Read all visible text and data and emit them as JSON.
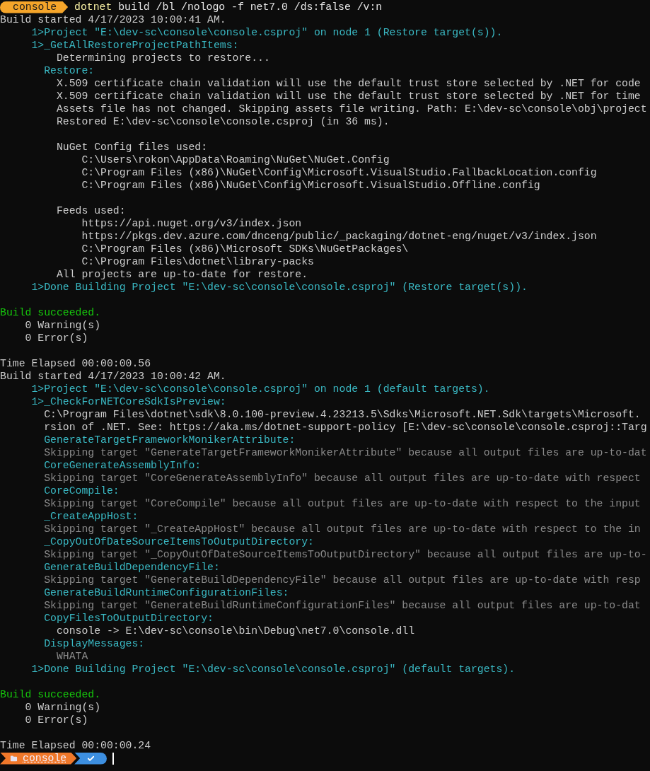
{
  "prompt": {
    "segment": "console",
    "command": "dotnet",
    "args": "build /bl /nologo -f net7.0 /ds:false /v:n"
  },
  "lines": [
    {
      "kind": "info",
      "text": "Build started 4/17/2023 10:00:41 AM."
    },
    {
      "kind": "target",
      "text": "     1>Project \"E:\\dev-sc\\console\\console.csproj\" on node 1 (Restore target(s))."
    },
    {
      "kind": "target",
      "text": "     1>_GetAllRestoreProjectPathItems:"
    },
    {
      "kind": "info",
      "text": "         Determining projects to restore..."
    },
    {
      "kind": "target",
      "text": "       Restore:"
    },
    {
      "kind": "info",
      "text": "         X.509 certificate chain validation will use the default trust store selected by .NET for code"
    },
    {
      "kind": "info",
      "text": "         X.509 certificate chain validation will use the default trust store selected by .NET for time"
    },
    {
      "kind": "info",
      "text": "         Assets file has not changed. Skipping assets file writing. Path: E:\\dev-sc\\console\\obj\\project"
    },
    {
      "kind": "info",
      "text": "         Restored E:\\dev-sc\\console\\console.csproj (in 36 ms)."
    },
    {
      "kind": "blank"
    },
    {
      "kind": "info",
      "text": "         NuGet Config files used:"
    },
    {
      "kind": "info",
      "text": "             C:\\Users\\rokon\\AppData\\Roaming\\NuGet\\NuGet.Config"
    },
    {
      "kind": "info",
      "text": "             C:\\Program Files (x86)\\NuGet\\Config\\Microsoft.VisualStudio.FallbackLocation.config"
    },
    {
      "kind": "info",
      "text": "             C:\\Program Files (x86)\\NuGet\\Config\\Microsoft.VisualStudio.Offline.config"
    },
    {
      "kind": "blank"
    },
    {
      "kind": "info",
      "text": "         Feeds used:"
    },
    {
      "kind": "info",
      "text": "             https://api.nuget.org/v3/index.json"
    },
    {
      "kind": "info",
      "text": "             https://pkgs.dev.azure.com/dnceng/public/_packaging/dotnet-eng/nuget/v3/index.json"
    },
    {
      "kind": "info",
      "text": "             C:\\Program Files (x86)\\Microsoft SDKs\\NuGetPackages\\"
    },
    {
      "kind": "info",
      "text": "             C:\\Program Files\\dotnet\\library-packs"
    },
    {
      "kind": "info",
      "text": "         All projects are up-to-date for restore."
    },
    {
      "kind": "target",
      "text": "     1>Done Building Project \"E:\\dev-sc\\console\\console.csproj\" (Restore target(s))."
    },
    {
      "kind": "blank"
    },
    {
      "kind": "success",
      "text": "Build succeeded."
    },
    {
      "kind": "info",
      "text": "    0 Warning(s)"
    },
    {
      "kind": "info",
      "text": "    0 Error(s)"
    },
    {
      "kind": "blank"
    },
    {
      "kind": "info",
      "text": "Time Elapsed 00:00:00.56"
    },
    {
      "kind": "info",
      "text": "Build started 4/17/2023 10:00:42 AM."
    },
    {
      "kind": "target",
      "text": "     1>Project \"E:\\dev-sc\\console\\console.csproj\" on node 1 (default targets)."
    },
    {
      "kind": "target",
      "text": "     1>_CheckForNETCoreSdkIsPreview:"
    },
    {
      "kind": "info",
      "text": "       C:\\Program Files\\dotnet\\sdk\\8.0.100-preview.4.23213.5\\Sdks\\Microsoft.NET.Sdk\\targets\\Microsoft."
    },
    {
      "kind": "info",
      "text": "       rsion of .NET. See: https://aka.ms/dotnet-support-policy [E:\\dev-sc\\console\\console.csproj::Targ"
    },
    {
      "kind": "target",
      "text": "       GenerateTargetFrameworkMonikerAttribute:"
    },
    {
      "kind": "dim",
      "text": "       Skipping target \"GenerateTargetFrameworkMonikerAttribute\" because all output files are up-to-dat"
    },
    {
      "kind": "target",
      "text": "       CoreGenerateAssemblyInfo:"
    },
    {
      "kind": "dim",
      "text": "       Skipping target \"CoreGenerateAssemblyInfo\" because all output files are up-to-date with respect"
    },
    {
      "kind": "target",
      "text": "       CoreCompile:"
    },
    {
      "kind": "dim",
      "text": "       Skipping target \"CoreCompile\" because all output files are up-to-date with respect to the input"
    },
    {
      "kind": "target",
      "text": "       _CreateAppHost:"
    },
    {
      "kind": "dim",
      "text": "       Skipping target \"_CreateAppHost\" because all output files are up-to-date with respect to the in"
    },
    {
      "kind": "target",
      "text": "       _CopyOutOfDateSourceItemsToOutputDirectory:"
    },
    {
      "kind": "dim",
      "text": "       Skipping target \"_CopyOutOfDateSourceItemsToOutputDirectory\" because all output files are up-to-"
    },
    {
      "kind": "target",
      "text": "       GenerateBuildDependencyFile:"
    },
    {
      "kind": "dim",
      "text": "       Skipping target \"GenerateBuildDependencyFile\" because all output files are up-to-date with resp"
    },
    {
      "kind": "target",
      "text": "       GenerateBuildRuntimeConfigurationFiles:"
    },
    {
      "kind": "dim",
      "text": "       Skipping target \"GenerateBuildRuntimeConfigurationFiles\" because all output files are up-to-dat"
    },
    {
      "kind": "target",
      "text": "       CopyFilesToOutputDirectory:"
    },
    {
      "kind": "info",
      "text": "         console -> E:\\dev-sc\\console\\bin\\Debug\\net7.0\\console.dll"
    },
    {
      "kind": "target",
      "text": "       DisplayMessages:"
    },
    {
      "kind": "dim",
      "text": "         WHATA"
    },
    {
      "kind": "target",
      "text": "     1>Done Building Project \"E:\\dev-sc\\console\\console.csproj\" (default targets)."
    },
    {
      "kind": "blank"
    },
    {
      "kind": "success",
      "text": "Build succeeded."
    },
    {
      "kind": "info",
      "text": "    0 Warning(s)"
    },
    {
      "kind": "info",
      "text": "    0 Error(s)"
    },
    {
      "kind": "blank"
    },
    {
      "kind": "info",
      "text": "Time Elapsed 00:00:00.24"
    }
  ],
  "bottom_prompt": {
    "segment": "console"
  }
}
